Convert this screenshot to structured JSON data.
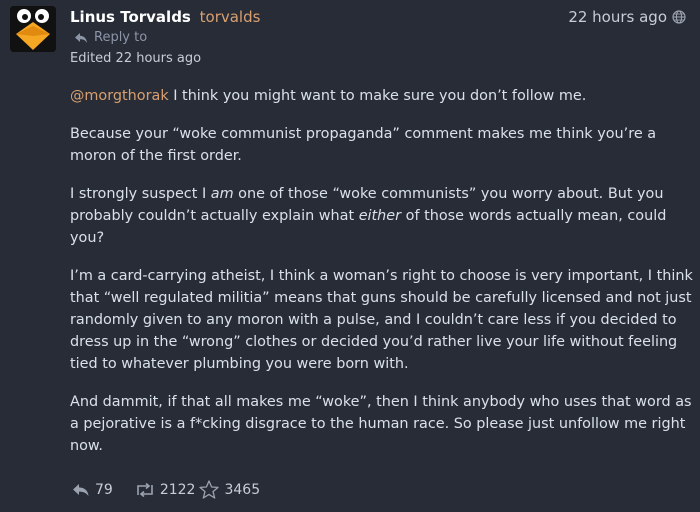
{
  "author": {
    "display_name": "Linus Torvalds",
    "handle": "torvalds",
    "avatar_icon": "penguin-avatar"
  },
  "meta": {
    "timestamp": "22 hours ago",
    "visibility_icon": "globe-icon",
    "reply_to_label": "Reply to",
    "edited_label": "Edited 22 hours ago"
  },
  "content": {
    "p1_mention": "@morgthorak",
    "p1_text": " I think you might want to make sure you don’t follow me.",
    "p2": "Because your “woke communist propaganda” comment makes me think you’re a moron of the first order.",
    "p3_a": "I strongly suspect I ",
    "p3_em1": "am",
    "p3_b": " one of those “woke communists” you worry about. But you probably couldn’t actually explain what ",
    "p3_em2": "either",
    "p3_c": " of those words actually mean, could you?",
    "p4": "I’m a card-carrying atheist, I think a woman’s right to choose is very important, I think that “well regulated militia” means that guns should be carefully licensed and not just randomly given to any moron with a pulse, and I couldn’t care less if you decided to dress up in the “wrong” clothes or decided you’d rather live your life without feeling tied to whatever plumbing you were born with.",
    "p5": "And dammit, if that all makes me “woke”, then I think anybody who uses that word as a pejorative is a f*cking disgrace to the human race. So please just unfollow me right now."
  },
  "actions": {
    "replies": "79",
    "boosts": "2122",
    "favourites": "3465"
  },
  "colors": {
    "background": "#282c37",
    "mention": "#d8a070",
    "text": "#d9e1e8"
  }
}
